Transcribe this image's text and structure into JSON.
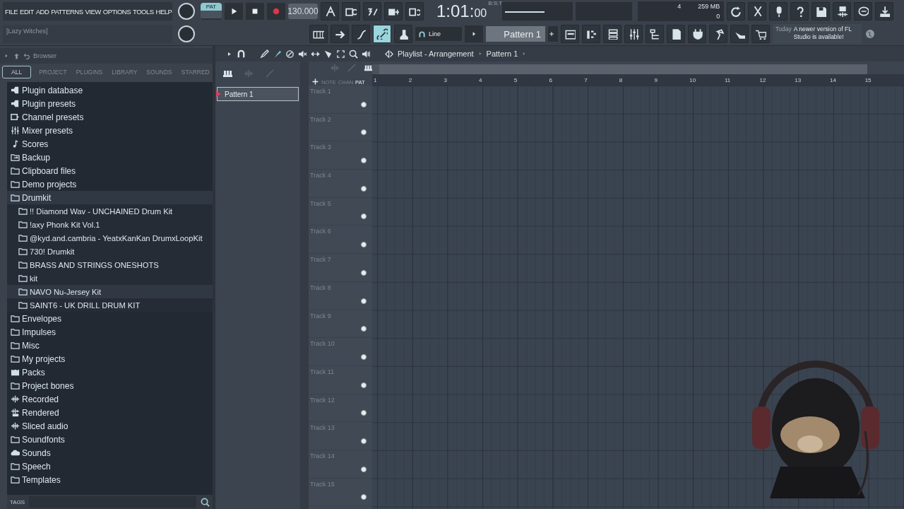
{
  "menu": [
    "FILE",
    "EDIT",
    "ADD",
    "PATTERNS",
    "VIEW",
    "OPTIONS",
    "TOOLS",
    "HELP"
  ],
  "hint": "[Lazy Witches]",
  "transport": {
    "mode": "PAT",
    "pattern_mode": true,
    "tempo": "130.000"
  },
  "time": {
    "main": "1:01:",
    "sub": "00",
    "label": "B:S:T"
  },
  "monitor": {
    "cpu": "4",
    "memory": "259 MB",
    "voices": "0"
  },
  "snap": "Line",
  "pattern_selector": "Pattern 1",
  "news": {
    "when": "Today",
    "text": "A newer version of FL Studio is available!"
  },
  "browser": {
    "title": "Browser",
    "tabs": [
      {
        "label": "ALL",
        "selected": true
      },
      {
        "label": "PROJECT",
        "selected": false
      },
      {
        "label": "PLUGINS",
        "selected": false
      },
      {
        "label": "LIBRARY",
        "selected": false
      },
      {
        "label": "SOUNDS",
        "selected": false
      },
      {
        "label": "STARRED",
        "selected": false
      }
    ],
    "items": [
      {
        "label": "Plugin database",
        "kind": "plugin",
        "selected": false
      },
      {
        "label": "Plugin presets",
        "kind": "plugin",
        "selected": false
      },
      {
        "label": "Channel presets",
        "kind": "channel",
        "selected": false
      },
      {
        "label": "Mixer presets",
        "kind": "mixer",
        "selected": false
      },
      {
        "label": "Scores",
        "kind": "score",
        "selected": false
      },
      {
        "label": "Backup",
        "kind": "backup",
        "selected": false
      },
      {
        "label": "Clipboard files",
        "kind": "folder",
        "selected": false
      },
      {
        "label": "Demo projects",
        "kind": "folder",
        "selected": false
      },
      {
        "label": "Drumkit",
        "kind": "folder",
        "selected": true,
        "children": [
          {
            "label": "!! Diamond Wav - UNCHAINED Drum Kit",
            "kind": "folder",
            "selected": false
          },
          {
            "label": "!axy Phonk Kit Vol.1",
            "kind": "folder",
            "selected": false
          },
          {
            "label": "@kyd.and.cambria - YeatxKanKan DrumxLoopKit",
            "kind": "folder",
            "selected": false
          },
          {
            "label": "730! Drumkit",
            "kind": "folder",
            "selected": false
          },
          {
            "label": "BRASS AND STRINGS ONESHOTS",
            "kind": "folder",
            "selected": false
          },
          {
            "label": "kit",
            "kind": "folder",
            "selected": false
          },
          {
            "label": "NAVO Nu-Jersey Kit",
            "kind": "folder",
            "selected": true
          },
          {
            "label": "SAINT6 - UK DRILL DRUM KIT",
            "kind": "folder",
            "selected": false
          }
        ]
      },
      {
        "label": "Envelopes",
        "kind": "folder",
        "selected": false
      },
      {
        "label": "Impulses",
        "kind": "folder",
        "selected": false
      },
      {
        "label": "Misc",
        "kind": "folder",
        "selected": false
      },
      {
        "label": "My projects",
        "kind": "folder",
        "selected": false
      },
      {
        "label": "Packs",
        "kind": "packs",
        "selected": false
      },
      {
        "label": "Project bones",
        "kind": "folder",
        "selected": false
      },
      {
        "label": "Recorded",
        "kind": "wave",
        "selected": false
      },
      {
        "label": "Rendered",
        "kind": "rendered",
        "selected": false
      },
      {
        "label": "Sliced audio",
        "kind": "wave",
        "selected": false
      },
      {
        "label": "Soundfonts",
        "kind": "folder",
        "selected": false
      },
      {
        "label": "Sounds",
        "kind": "cloud",
        "selected": false
      },
      {
        "label": "Speech",
        "kind": "folder",
        "selected": false
      },
      {
        "label": "Templates",
        "kind": "folder",
        "selected": false
      }
    ],
    "footer": "TAGS"
  },
  "playlist": {
    "title": "Playlist - Arrangement",
    "pattern": "Pattern 1",
    "modes": [
      {
        "label": "NOTE",
        "selected": false
      },
      {
        "label": "CHAN",
        "selected": false
      },
      {
        "label": "PAT",
        "selected": true
      }
    ],
    "patterns": [
      {
        "name": "Pattern 1",
        "selected": true
      }
    ],
    "tracks": [
      "Track 1",
      "Track 2",
      "Track 3",
      "Track 4",
      "Track 5",
      "Track 6",
      "Track 7",
      "Track 8",
      "Track 9",
      "Track 10",
      "Track 11",
      "Track 12",
      "Track 13",
      "Track 14",
      "Track 15"
    ],
    "bars": [
      "1",
      "2",
      "3",
      "4",
      "5",
      "6",
      "7",
      "8",
      "9",
      "10",
      "11",
      "12",
      "13",
      "14",
      "15"
    ]
  }
}
